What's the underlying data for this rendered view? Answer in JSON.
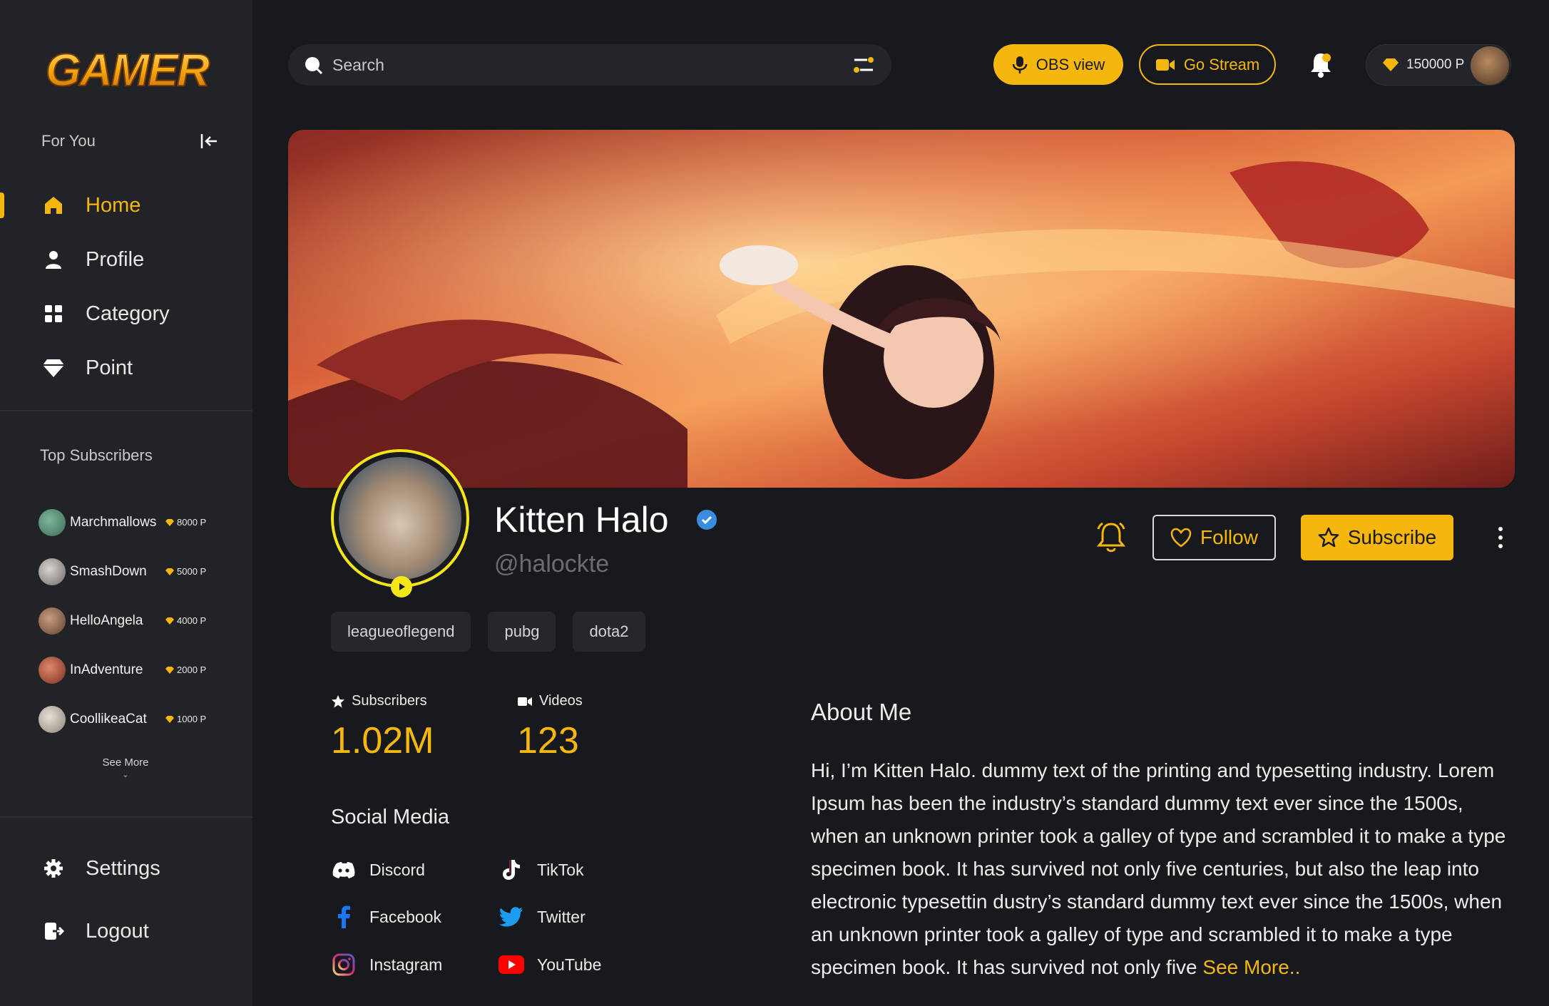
{
  "brand": {
    "logo_text": "GAMER",
    "accent": "#f5b70e"
  },
  "sidebar": {
    "for_you_label": "For You",
    "nav": [
      {
        "label": "Home",
        "icon": "home-icon",
        "active": true
      },
      {
        "label": "Profile",
        "icon": "user-icon"
      },
      {
        "label": "Category",
        "icon": "grid-icon"
      },
      {
        "label": "Point",
        "icon": "diamond-icon"
      }
    ],
    "top_subscribers_title": "Top Subscribers",
    "top_subscribers": [
      {
        "name": "Marchmallows",
        "points": "8000 P"
      },
      {
        "name": "SmashDown",
        "points": "5000 P"
      },
      {
        "name": "HelloAngela",
        "points": "4000 P"
      },
      {
        "name": "InAdventure",
        "points": "2000 P"
      },
      {
        "name": "CoollikeaCat",
        "points": "1000 P"
      }
    ],
    "see_more": "See More",
    "settings_label": "Settings",
    "logout_label": "Logout"
  },
  "topbar": {
    "search_placeholder": "Search",
    "obs_label": "OBS view",
    "go_stream_label": "Go Stream",
    "points": "150000 P"
  },
  "profile": {
    "name": "Kitten Halo",
    "handle": "@halockte",
    "follow_label": "Follow",
    "subscribe_label": "Subscribe",
    "tags": [
      "leagueoflegend",
      "pubg",
      "dota2"
    ],
    "stats": {
      "subscribers_label": "Subscribers",
      "subscribers_value": "1.02M",
      "videos_label": "Videos",
      "videos_value": "123"
    },
    "social_title": "Social Media",
    "social": {
      "discord": "Discord",
      "tiktok": "TikTok",
      "facebook": "Facebook",
      "twitter": "Twitter",
      "instagram": "Instagram",
      "youtube": "YouTube"
    },
    "about_title": "About Me",
    "about_text": "Hi, I’m Kitten Halo. dummy text of the printing and typesetting industry. Lorem Ipsum has been the industry’s standard dummy text ever since the 1500s, when an unknown printer took a galley of type and scrambled it to make a type specimen book. It has survived not only five centuries, but also the leap into electronic typesettin  dustry’s standard dummy text ever since the 1500s, when an unknown printer took a galley of type and scrambled it to make a type specimen book. It has survived not only five",
    "about_see_more": "See More.."
  }
}
